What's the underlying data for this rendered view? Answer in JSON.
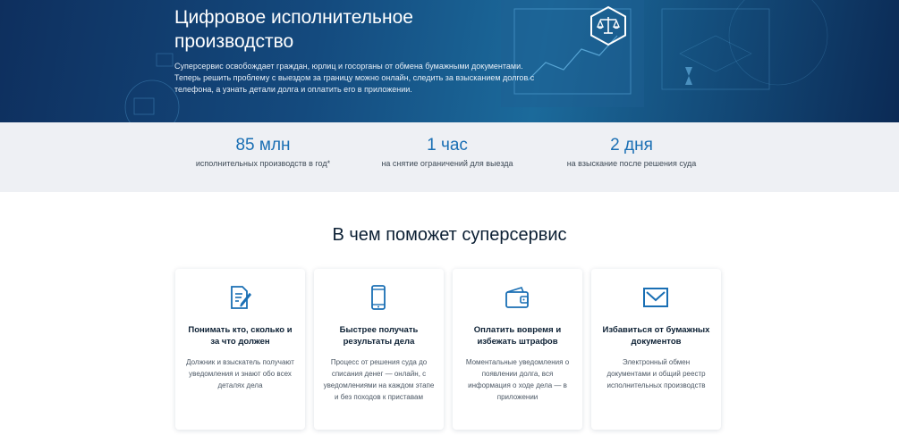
{
  "hero": {
    "title": "Цифровое исполнительное производство",
    "description": "Суперсервис освобождает граждан, юрлиц и госорганы от обмена бумажными документами. Теперь решить проблему с выездом за границу можно онлайн, следить за взысканием долгов с телефона, а узнать детали долга и оплатить его в приложении.",
    "emblem_icon": "scales-icon"
  },
  "stats": [
    {
      "value": "85 млн",
      "label": "исполнительных производств в год*"
    },
    {
      "value": "1 час",
      "label": "на снятие ограничений для выезда"
    },
    {
      "value": "2 дня",
      "label": "на взыскание после решения суда"
    }
  ],
  "section": {
    "title": "В чем поможет суперсервис"
  },
  "cards": [
    {
      "icon": "document-edit-icon",
      "title": "Понимать кто, сколько и за что должен",
      "text": "Должник и взыскатель получают уведомления и знают обо всех деталях дела"
    },
    {
      "icon": "smartphone-icon",
      "title": "Быстрее получать результаты дела",
      "text": "Процесс от решения суда до списания денег — онлайн, с уведомлениями на каждом этапе и без походов к приставам"
    },
    {
      "icon": "wallet-icon",
      "title": "Оплатить вовремя и избежать штрафов",
      "text": "Моментальные уведомления о появлении долга, вся информация о ходе дела — в приложении"
    },
    {
      "icon": "envelope-icon",
      "title": "Избавиться от бумажных документов",
      "text": "Электронный обмен документами и общий реестр исполнительных производств"
    }
  ],
  "colors": {
    "accent": "#1a6fb4",
    "hero_dark": "#0e2f5e",
    "band": "#eef0f4"
  }
}
